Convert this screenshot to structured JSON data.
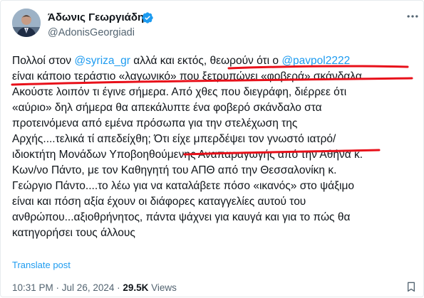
{
  "author": {
    "display_name": "Άδωνις Γεωργιάδης",
    "handle": "@AdonisGeorgiadi"
  },
  "tweet": {
    "lines": [
      [
        {
          "t": "Πολλοί στον "
        },
        {
          "t": "@syriza_gr",
          "mention": true
        },
        {
          "t": " αλλά και εκτός, θεωρούν ότι ο "
        },
        {
          "t": "@pavpol2222",
          "mention": true
        }
      ],
      [
        {
          "t": "είναι κάποιο τεράστιο «λαγωνικό» που ξετρυπώνει «φοβερά» σκάνδαλα."
        }
      ],
      [
        {
          "t": "Ακούστε λοιπόν τι έγινε σήμερα. Από χθες που διεγράφη, διέρρεε ότι"
        }
      ],
      [
        {
          "t": "«αύριο» δηλ σήμερα θα απεκάλυπτε ένα φοβερό σκάνδαλο στα"
        }
      ],
      [
        {
          "t": "προτεινόμενα από εμένα πρόσωπα για την στελέχωση της"
        }
      ],
      [
        {
          "t": "Αρχής....τελικά τί απεδείχθη; Ότι είχε μπερδέψει τον γνωστό ιατρό/"
        }
      ],
      [
        {
          "t": "ιδιοκτήτη Μονάδων Υποβοηθούμενης Αναπαραγωγής από την Αθήνα κ."
        }
      ],
      [
        {
          "t": "Κων/νο Πάντο, με τον Καθηγητή του ΑΠΘ από την Θεσσαλονίκη κ."
        }
      ],
      [
        {
          "t": "Γεώργιο Πάντο....το λέω για να καταλάβετε πόσο «ικανός» στο ψάξιμο"
        }
      ],
      [
        {
          "t": "είναι και πόση αξία έχουν οι διάφορες καταγγελίες αυτού του"
        }
      ],
      [
        {
          "t": "ανθρώπου...αξιοθρήνητος, πάντα ψάχνει για καυγά και για το πώς θα"
        }
      ],
      [
        {
          "t": "κατηγορήσει τους άλλους"
        }
      ]
    ]
  },
  "translate_label": "Translate post",
  "meta": {
    "time": "10:31 PM",
    "separator": " · ",
    "date": "Jul 26, 2024",
    "views_count": "29.5K",
    "views_label": " Views"
  },
  "icons": {
    "verified": "verified-badge-icon",
    "more": "more-options-icon",
    "bookmark": "bookmark-icon"
  },
  "colors": {
    "mention": "#1d9bf0",
    "annotation": "#e8101a",
    "secondary_text": "#536471"
  }
}
